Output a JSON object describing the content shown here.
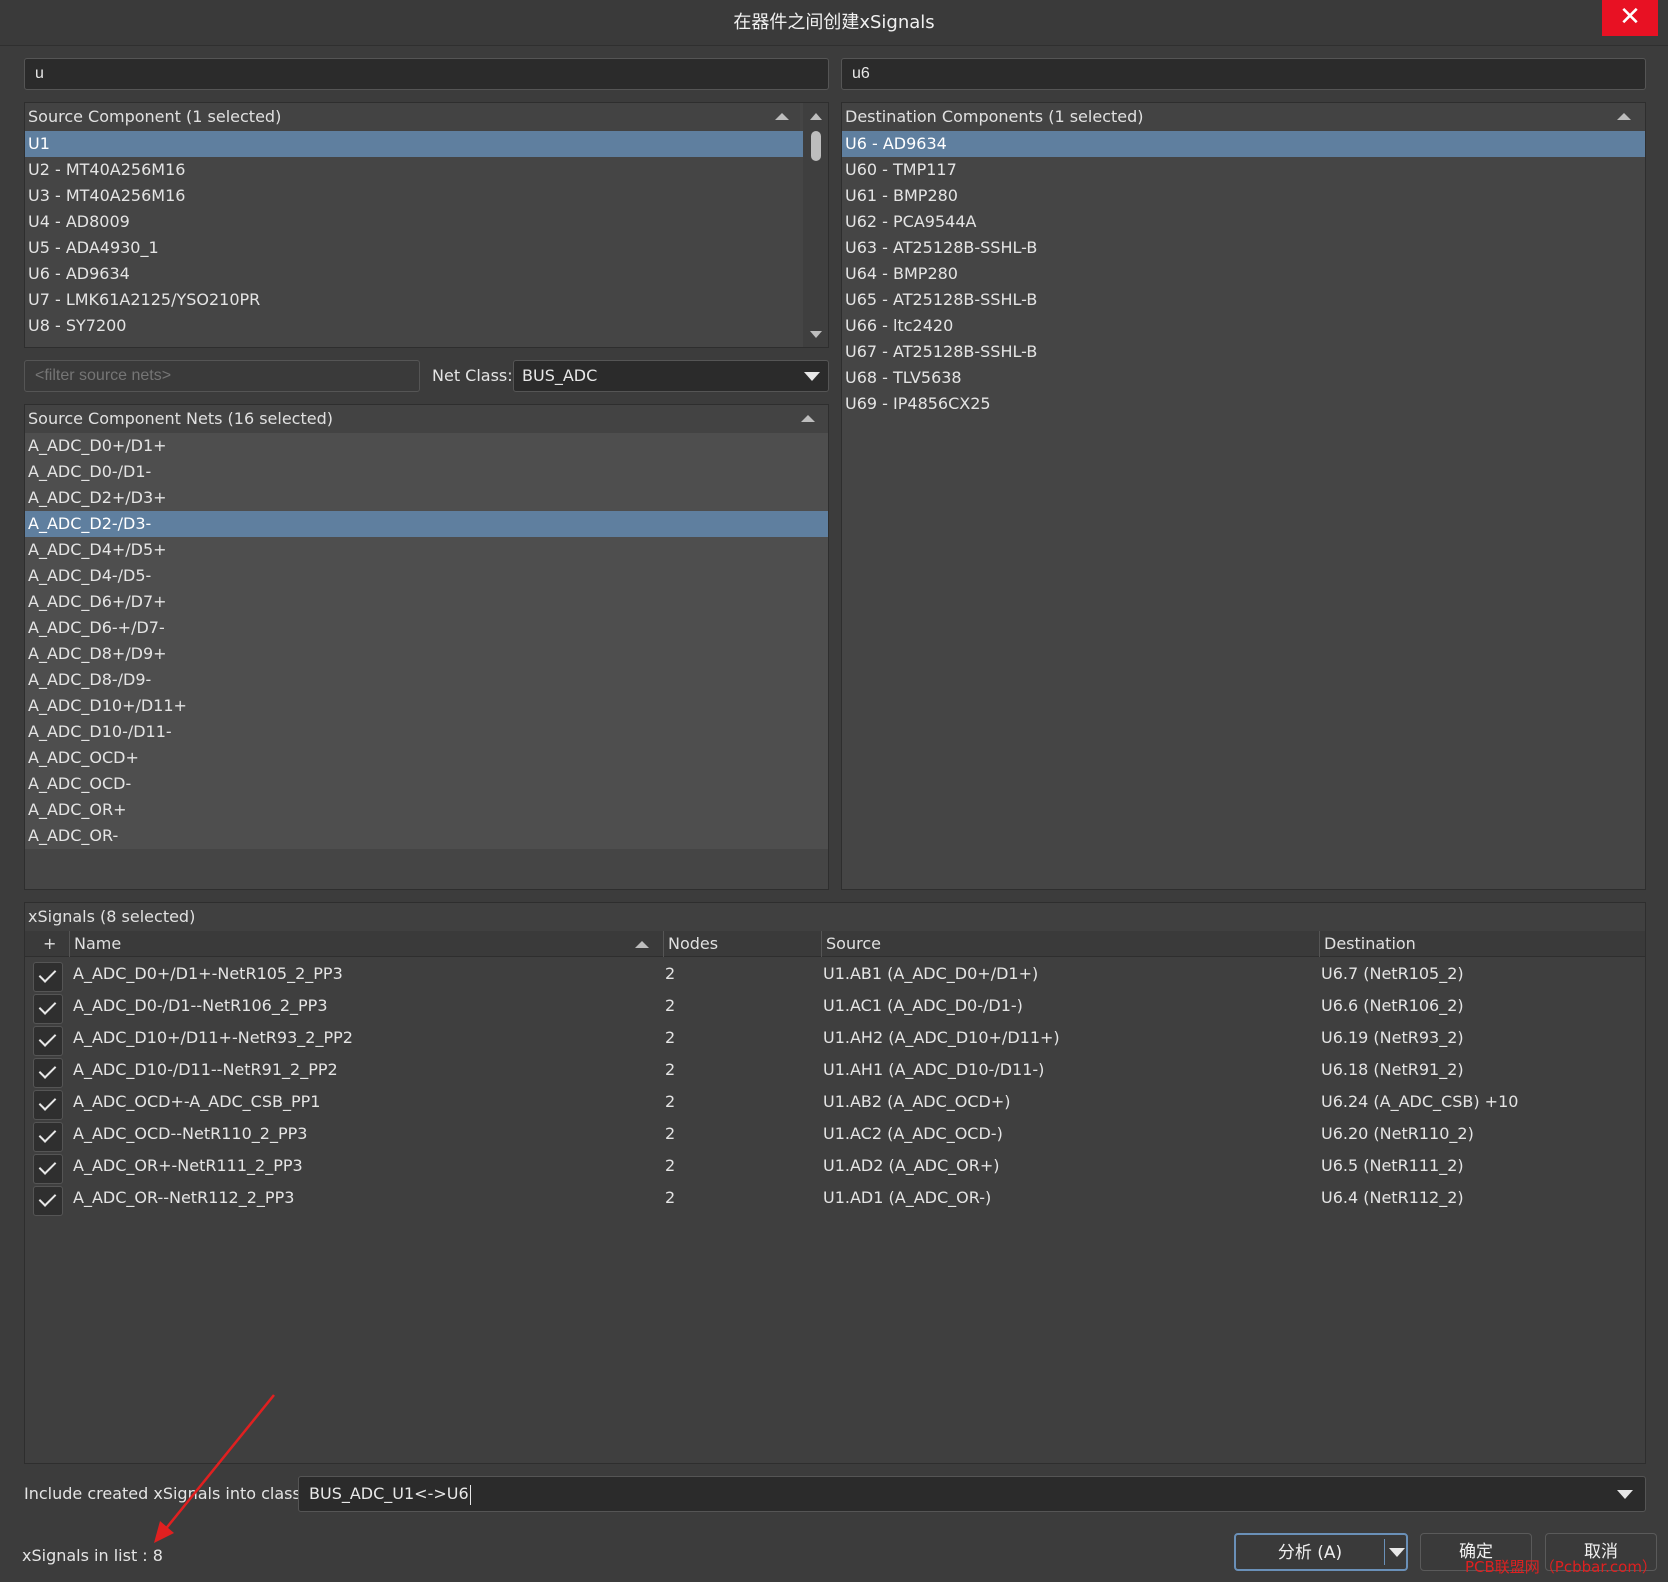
{
  "window": {
    "title": "在器件之间创建xSignals",
    "close_label": "✕"
  },
  "source_search": {
    "value": "u"
  },
  "dest_search": {
    "value": "u6"
  },
  "source_components": {
    "header": "Source Component (1 selected)",
    "items": [
      {
        "label": "U1",
        "selected": true
      },
      {
        "label": "U2 - MT40A256M16",
        "selected": false
      },
      {
        "label": "U3 - MT40A256M16",
        "selected": false
      },
      {
        "label": "U4 - AD8009",
        "selected": false
      },
      {
        "label": "U5 - ADA4930_1",
        "selected": false
      },
      {
        "label": "U6 - AD9634",
        "selected": false
      },
      {
        "label": "U7 - LMK61A2125/YSO210PR",
        "selected": false
      },
      {
        "label": "U8 - SY7200",
        "selected": false
      }
    ]
  },
  "destination_components": {
    "header": "Destination Components (1 selected)",
    "items": [
      {
        "label": "U6 - AD9634",
        "selected": true
      },
      {
        "label": "U60 - TMP117",
        "selected": false
      },
      {
        "label": "U61 - BMP280",
        "selected": false
      },
      {
        "label": "U62 - PCA9544A",
        "selected": false
      },
      {
        "label": "U63 - AT25128B-SSHL-B",
        "selected": false
      },
      {
        "label": "U64 - BMP280",
        "selected": false
      },
      {
        "label": "U65 - AT25128B-SSHL-B",
        "selected": false
      },
      {
        "label": "U66 - ltc2420",
        "selected": false
      },
      {
        "label": "U67 - AT25128B-SSHL-B",
        "selected": false
      },
      {
        "label": "U68 - TLV5638",
        "selected": false
      },
      {
        "label": "U69 - IP4856CX25",
        "selected": false
      }
    ]
  },
  "net_filter": {
    "placeholder": "<filter source nets>"
  },
  "net_class": {
    "label": "Net Class:",
    "value": "BUS_ADC"
  },
  "source_nets": {
    "header": "Source Component Nets (16 selected)",
    "items": [
      "A_ADC_D0+/D1+",
      "A_ADC_D0-/D1-",
      "A_ADC_D2+/D3+",
      "A_ADC_D2-/D3-",
      "A_ADC_D4+/D5+",
      "A_ADC_D4-/D5-",
      "A_ADC_D6+/D7+",
      "A_ADC_D6-+/D7-",
      "A_ADC_D8+/D9+",
      "A_ADC_D8-/D9-",
      "A_ADC_D10+/D11+",
      "A_ADC_D10-/D11-",
      "A_ADC_OCD+",
      "A_ADC_OCD-",
      "A_ADC_OR+",
      "A_ADC_OR-"
    ],
    "highlighted_index": 3
  },
  "xsignals": {
    "header": "xSignals (8 selected)",
    "columns": {
      "plus": "+",
      "name": "Name",
      "nodes": "Nodes",
      "source": "Source",
      "destination": "Destination"
    },
    "rows": [
      {
        "name": "A_ADC_D0+/D1+-NetR105_2_PP3",
        "nodes": "2",
        "source": "U1.AB1 (A_ADC_D0+/D1+)",
        "destination": "U6.7 (NetR105_2)"
      },
      {
        "name": "A_ADC_D0-/D1--NetR106_2_PP3",
        "nodes": "2",
        "source": "U1.AC1 (A_ADC_D0-/D1-)",
        "destination": "U6.6 (NetR106_2)"
      },
      {
        "name": "A_ADC_D10+/D11+-NetR93_2_PP2",
        "nodes": "2",
        "source": "U1.AH2 (A_ADC_D10+/D11+)",
        "destination": "U6.19 (NetR93_2)"
      },
      {
        "name": "A_ADC_D10-/D11--NetR91_2_PP2",
        "nodes": "2",
        "source": "U1.AH1 (A_ADC_D10-/D11-)",
        "destination": "U6.18 (NetR91_2)"
      },
      {
        "name": "A_ADC_OCD+-A_ADC_CSB_PP1",
        "nodes": "2",
        "source": "U1.AB2 (A_ADC_OCD+)",
        "destination": "U6.24 (A_ADC_CSB) +10"
      },
      {
        "name": "A_ADC_OCD--NetR110_2_PP3",
        "nodes": "2",
        "source": "U1.AC2 (A_ADC_OCD-)",
        "destination": "U6.20 (NetR110_2)"
      },
      {
        "name": "A_ADC_OR+-NetR111_2_PP3",
        "nodes": "2",
        "source": "U1.AD2 (A_ADC_OR+)",
        "destination": "U6.5 (NetR111_2)"
      },
      {
        "name": "A_ADC_OR--NetR112_2_PP3",
        "nodes": "2",
        "source": "U1.AD1 (A_ADC_OR-)",
        "destination": "U6.4 (NetR112_2)"
      }
    ]
  },
  "include_class": {
    "label": "Include created xSignals into class:",
    "value": "BUS_ADC_U1<->U6"
  },
  "footer": {
    "count_text": "xSignals in list : 8",
    "analyze_button": "分析 (A)",
    "ok_button": "确定",
    "cancel_button": "取消",
    "watermark": "PCB联盟网（Pcbbar.com）"
  },
  "colors": {
    "selection": "#5f7f9f",
    "close": "#e81123",
    "annotation_arrow": "#e02020"
  }
}
